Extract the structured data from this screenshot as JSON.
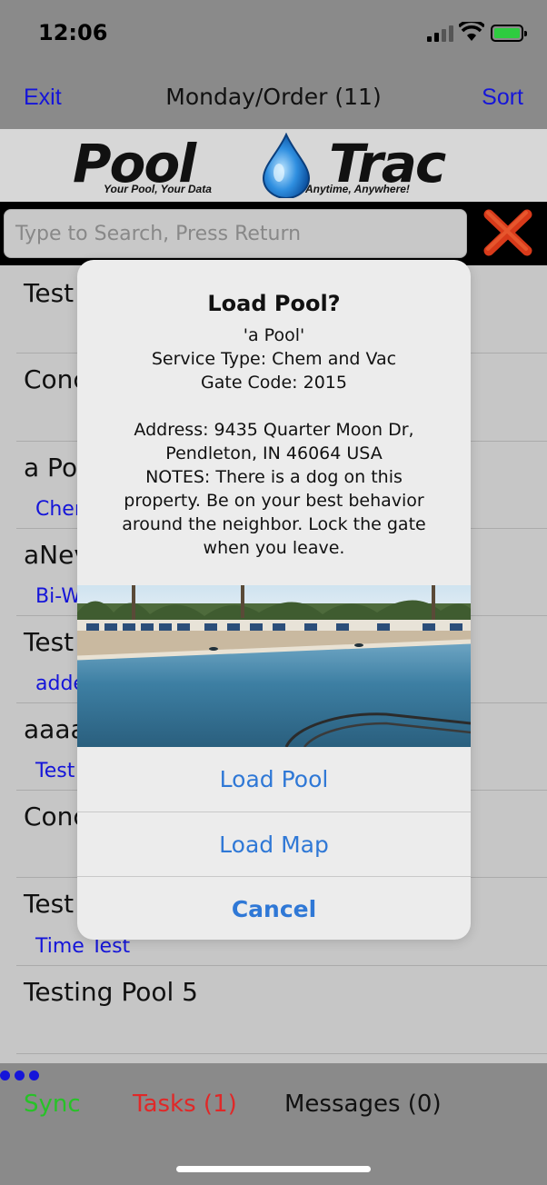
{
  "status": {
    "time": "12:06"
  },
  "nav": {
    "left": "Exit",
    "title": "Monday/Order (11)",
    "right": "Sort"
  },
  "logo": {
    "word1": "Pool",
    "word2": "Trac",
    "tagline_left": "Your Pool, Your Data",
    "tagline_right": "Anytime, Anywhere!"
  },
  "search": {
    "placeholder": "Type to Search, Press Return"
  },
  "list": [
    {
      "title": "Test",
      "subtitle": ""
    },
    {
      "title": "Conc",
      "subtitle": ""
    },
    {
      "title": "a Po",
      "subtitle": "Cher"
    },
    {
      "title": "aNev",
      "subtitle": "Bi-W"
    },
    {
      "title": "Test",
      "subtitle": "adde"
    },
    {
      "title": "aaaa",
      "subtitle": "Test"
    },
    {
      "title": "Conc",
      "subtitle": ""
    },
    {
      "title": "Test",
      "subtitle": "Time Test"
    },
    {
      "title": "Testing Pool 5",
      "subtitle": ""
    }
  ],
  "tabs": {
    "sync": "Sync",
    "tasks": "Tasks (1)",
    "messages": "Messages (0)"
  },
  "alert": {
    "title": "Load Pool?",
    "lines": [
      "'a Pool'",
      "Service Type: Chem and Vac",
      "Gate Code: 2015",
      "",
      "Address: 9435 Quarter Moon Dr,",
      "Pendleton, IN 46064 USA",
      "NOTES: There is a dog on this",
      "property.  Be on your best behavior",
      "around the neighbor.  Lock the gate",
      "when you leave."
    ],
    "buttons": {
      "load_pool": "Load Pool",
      "load_map": "Load Map",
      "cancel": "Cancel"
    }
  },
  "colors": {
    "link_blue": "#1515d9",
    "alert_blue": "#2f78d6",
    "sync_green": "#27c227",
    "tasks_red": "#e02828",
    "clear_x_red": "#d83a1a"
  }
}
